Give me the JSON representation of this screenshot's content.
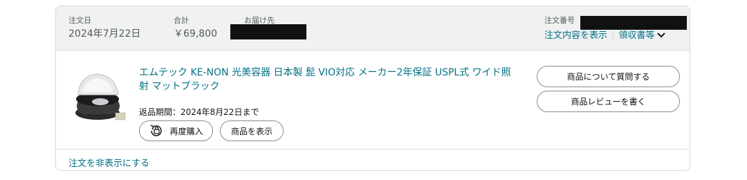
{
  "order_header": {
    "order_date_label": "注文日",
    "order_date": "2024年7月22日",
    "total_label": "合計",
    "total": "￥69,800",
    "ship_to_label": "お届け先",
    "order_number_label": "注文番号",
    "order_details_link": "注文内容を表示",
    "receipt_link": "領収書等"
  },
  "item": {
    "title": "エムテック KE-NON 光美容器 日本製 髭 VIO対応 メーカー2年保証 USPL式 ワイド照射 マットブラック",
    "return_window": "返品期間：2024年8月22日まで",
    "buy_again_label": "再度購入",
    "view_item_label": "商品を表示"
  },
  "actions": {
    "ask_question_label": "商品について質問する",
    "write_review_label": "商品レビューを書く"
  },
  "footer": {
    "hide_order_label": "注文を非表示にする"
  },
  "colors": {
    "link": "#007185",
    "header_bg": "#f0f2f2",
    "border": "#d5d9d9"
  }
}
